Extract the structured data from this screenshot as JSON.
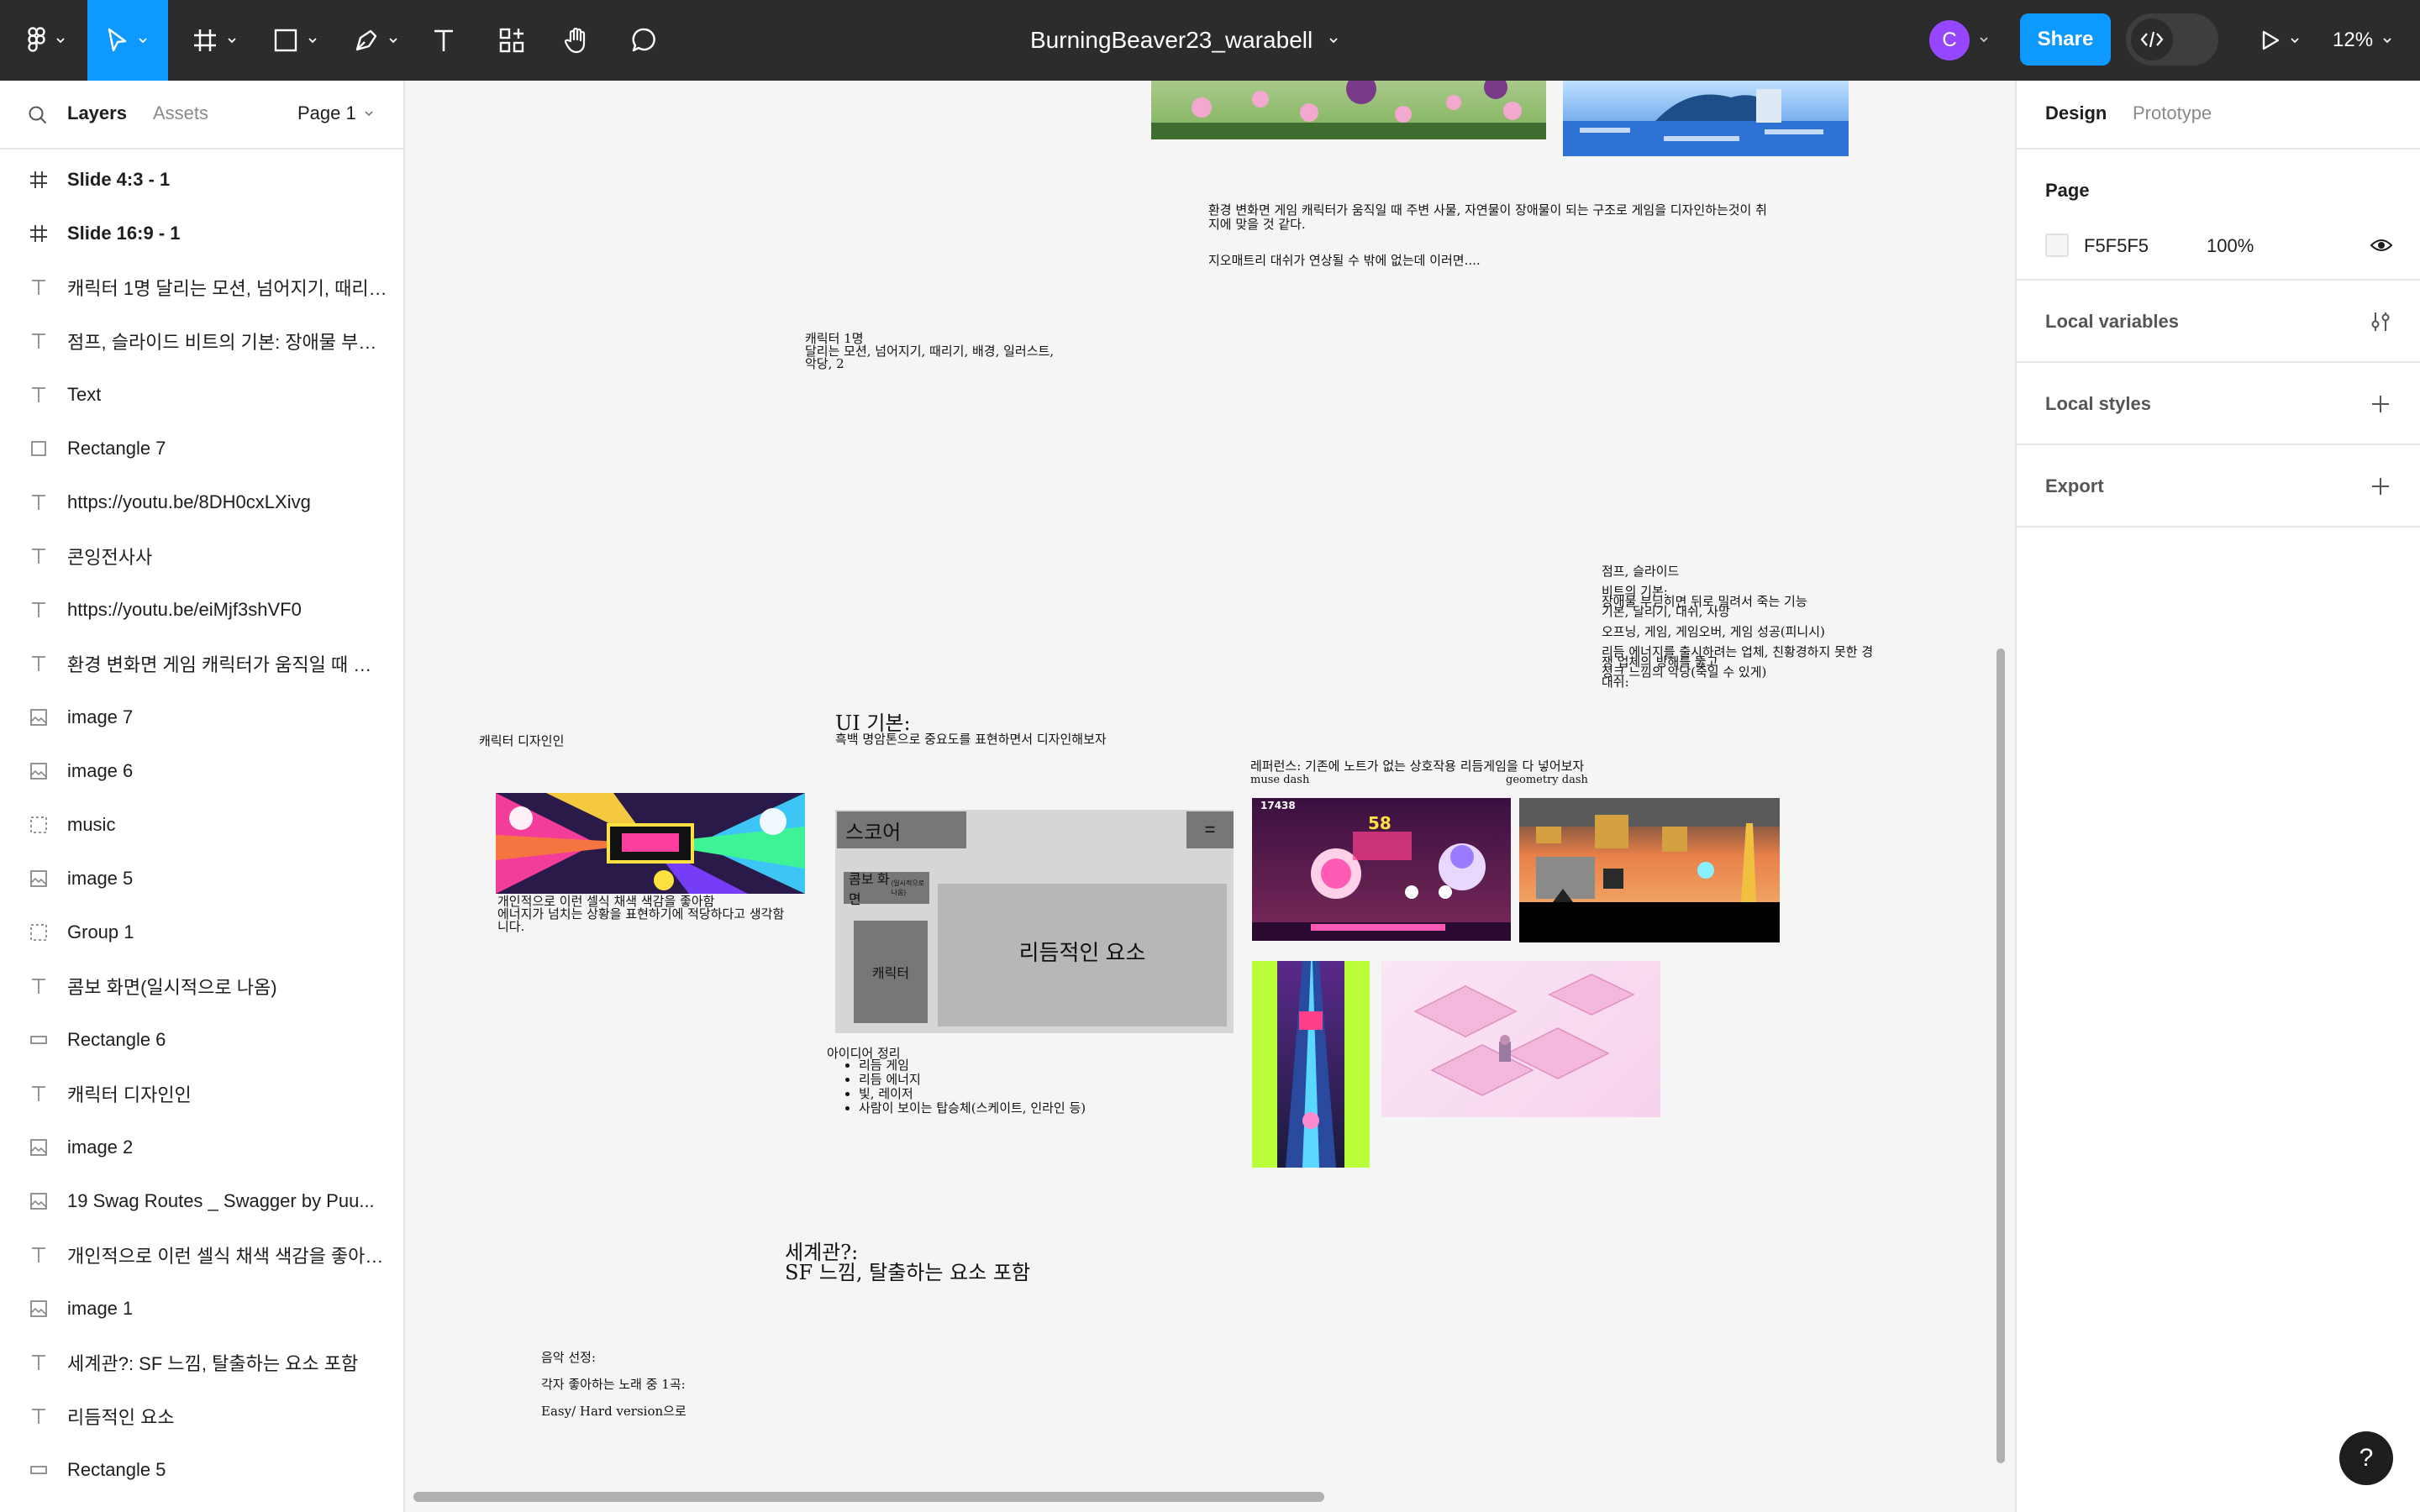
{
  "toolbar": {
    "file_title": "BurningBeaver23_warabell",
    "avatar_initial": "C",
    "share_label": "Share",
    "zoom_label": "12%"
  },
  "left_panel": {
    "tab_layers": "Layers",
    "tab_assets": "Assets",
    "page_select": "Page 1",
    "layers": [
      {
        "label": "Slide 4:3 - 1",
        "icon": "frame-icon",
        "bold": true
      },
      {
        "label": "Slide 16:9 - 1",
        "icon": "frame-icon",
        "bold": true
      },
      {
        "label": "캐릭터 1명 달리는 모션, 넘어지기, 때리기...",
        "icon": "text-icon"
      },
      {
        "label": "점프, 슬라이드 비트의 기본: 장애물 부딛...",
        "icon": "text-icon"
      },
      {
        "label": "Text",
        "icon": "text-icon"
      },
      {
        "label": "Rectangle 7",
        "icon": "rectangle-icon"
      },
      {
        "label": "https://youtu.be/8DH0cxLXivg",
        "icon": "text-icon"
      },
      {
        "label": "콘잉전사사",
        "icon": "text-icon"
      },
      {
        "label": "https://youtu.be/eiMjf3shVF0",
        "icon": "text-icon"
      },
      {
        "label": "환경 변화면 게임 캐릭터가 움직일 때 주변...",
        "icon": "text-icon"
      },
      {
        "label": "image 7",
        "icon": "image-icon"
      },
      {
        "label": "image 6",
        "icon": "image-icon"
      },
      {
        "label": "music",
        "icon": "group-icon"
      },
      {
        "label": "image 5",
        "icon": "image-icon"
      },
      {
        "label": "Group 1",
        "icon": "group-icon"
      },
      {
        "label": "콤보 화면(일시적으로 나옴)",
        "icon": "text-icon"
      },
      {
        "label": "Rectangle 6",
        "icon": "rect-thin-icon"
      },
      {
        "label": "캐릭터 디자인인",
        "icon": "text-icon"
      },
      {
        "label": "image 2",
        "icon": "image-icon"
      },
      {
        "label": "19 Swag Routes _ Swagger by Puu...",
        "icon": "image-icon"
      },
      {
        "label": "개인적으로 이런 셀식 채색 색감을 좋아함 ...",
        "icon": "text-icon"
      },
      {
        "label": "image 1",
        "icon": "image-icon"
      },
      {
        "label": "세계관?: SF 느낌, 탈출하는 요소 포함",
        "icon": "text-icon"
      },
      {
        "label": "리듬적인 요소",
        "icon": "text-icon"
      },
      {
        "label": "Rectangle 5",
        "icon": "rect-thin-icon"
      }
    ]
  },
  "right_panel": {
    "tab_design": "Design",
    "tab_prototype": "Prototype",
    "page_title": "Page",
    "page_color": "F5F5F5",
    "page_opacity": "100%",
    "local_variables": "Local variables",
    "local_styles": "Local styles",
    "export": "Export",
    "help": "?"
  },
  "canvas": {
    "env_note_1": "환경 변화면 게임 캐릭터가 움직일 때 주변 사물, 자연물이 장애물이 되는 구조로 게임을 디자인하는것이 취\n지에 맞을 것 같다.",
    "env_note_2": "지오매트리 대쉬가 연상될 수 밖에 없는데 이러면....",
    "character_note": "캐릭터 1명\n달리는 모션, 넘어지기, 때리기, 배경, 일러스트,\n악당, 2",
    "jump_note": "점프, 슬라이드\n\n비트의 기본:\n장애물 부딛히면 뒤로 밀려서 죽는 기능\n기본, 달리기, 대쉬, 사망\n\n오프닝, 게임, 게임오버, 게임 성공(피니시)\n\n리듬 에너지를 출시하려는 업체, 친황경하지 못한 경\n쟁 업체의 방해를 뚫고\n정크 느낌의 악당(죽일 수 있게)\n대쉬:",
    "char_design_label": "캐릭터 디자인인",
    "ui_basic_title": "UI 기본:",
    "ui_basic_desc": "흑백 명암톤으로 중요도를 표현하면서 디자인해보자",
    "reference_title": "레퍼런스: 기존에 노트가 없는 상호작용 리듬게임을 다 넣어보자",
    "ref_muse": "muse dash",
    "ref_geometry": "geometry dash",
    "color_note": "개인적으로 이런 셀식 채색 색감을 좋아함\n에너지가 넘치는 상황을 표현하기에 적당하다고 생각함\n니다.",
    "mock_score": "스코어",
    "mock_menu": "=",
    "mock_combo": "콤보 화면",
    "mock_combo_note": "(일시적으로 나옴)",
    "mock_character": "캐릭터",
    "mock_rhythm": "리듬적인 요소",
    "ideas_title": "아이디어 정리",
    "ideas": [
      "리듬 게임",
      "리듬 에너지",
      "빛, 레이저",
      "사람이 보이는 탑승체(스케이트, 인라인 등)"
    ],
    "world_title": "세계관?:",
    "world_desc": "SF 느낌, 탈출하는 요소 포함",
    "music_1": "음악 선정:",
    "music_2": "각자 좋아하는 노래 중 1곡:",
    "music_3": "Easy/ Hard version으로",
    "muse_score": "17438",
    "muse_combo": "58"
  },
  "colors": {
    "toolbar_bg": "#2c2c2c",
    "accent": "#0d99ff",
    "avatar": "#9747ff",
    "canvas_bg": "#f5f5f5"
  }
}
